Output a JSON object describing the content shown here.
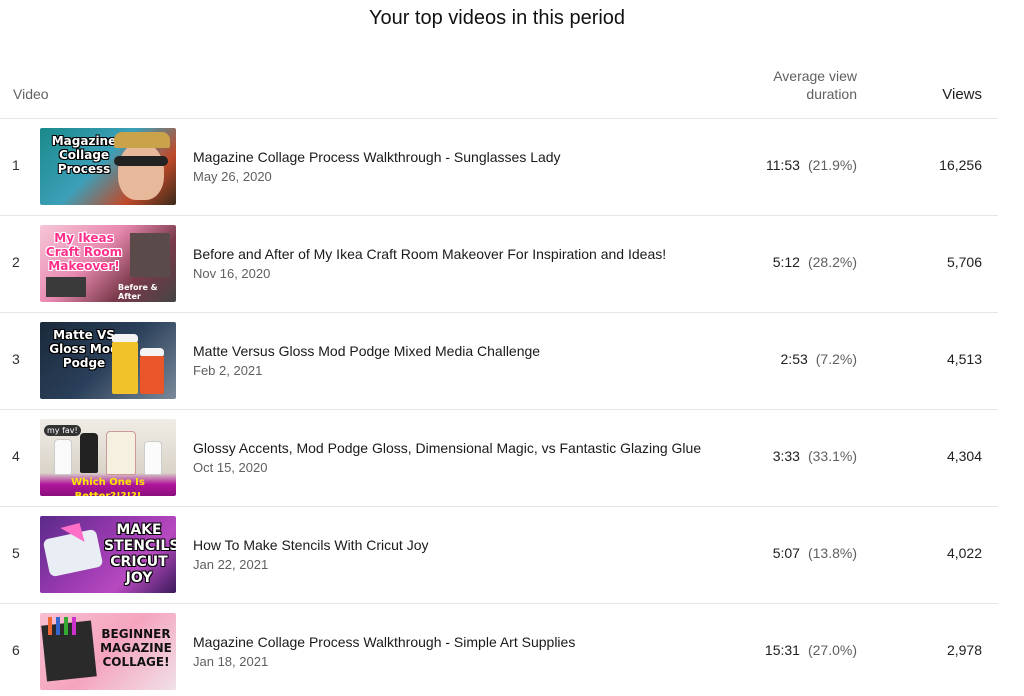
{
  "page_title": "Your top videos in this period",
  "columns": {
    "video": "Video",
    "avg_view_duration": "Average view duration",
    "views": "Views"
  },
  "rows": [
    {
      "rank": "1",
      "thumb_text": "Magazine Collage Process",
      "title": "Magazine Collage Process Walkthrough - Sunglasses Lady",
      "date": "May 26, 2020",
      "avg_duration": "11:53",
      "avg_percent": "(21.9%)",
      "views": "16,256"
    },
    {
      "rank": "2",
      "thumb_text": "My Ikeas Craft Room Makeover!",
      "thumb_subtext": "Before & After",
      "title": "Before and After of My Ikea Craft Room Makeover For Inspiration and Ideas!",
      "date": "Nov 16, 2020",
      "avg_duration": "5:12",
      "avg_percent": "(28.2%)",
      "views": "5,706"
    },
    {
      "rank": "3",
      "thumb_text": "Matte VS Gloss Mod Podge",
      "title": "Matte Versus Gloss Mod Podge Mixed Media Challenge",
      "date": "Feb 2, 2021",
      "avg_duration": "2:53",
      "avg_percent": "(7.2%)",
      "views": "4,513"
    },
    {
      "rank": "4",
      "thumb_text": "Which One Is Better?!?!?!",
      "thumb_subtext": "my fav!",
      "title": "Glossy Accents, Mod Podge Gloss, Dimensional Magic, vs Fantastic Glazing Glue",
      "date": "Oct 15, 2020",
      "avg_duration": "3:33",
      "avg_percent": "(33.1%)",
      "views": "4,304"
    },
    {
      "rank": "5",
      "thumb_text": "MAKE STENCILS CRICUT JOY",
      "title": "How To Make Stencils With Cricut Joy",
      "date": "Jan 22, 2021",
      "avg_duration": "5:07",
      "avg_percent": "(13.8%)",
      "views": "4,022"
    },
    {
      "rank": "6",
      "thumb_text": "BEGINNER MAGAZINE COLLAGE!",
      "title": "Magazine Collage Process Walkthrough - Simple Art Supplies",
      "date": "Jan 18, 2021",
      "avg_duration": "15:31",
      "avg_percent": "(27.0%)",
      "views": "2,978"
    }
  ]
}
